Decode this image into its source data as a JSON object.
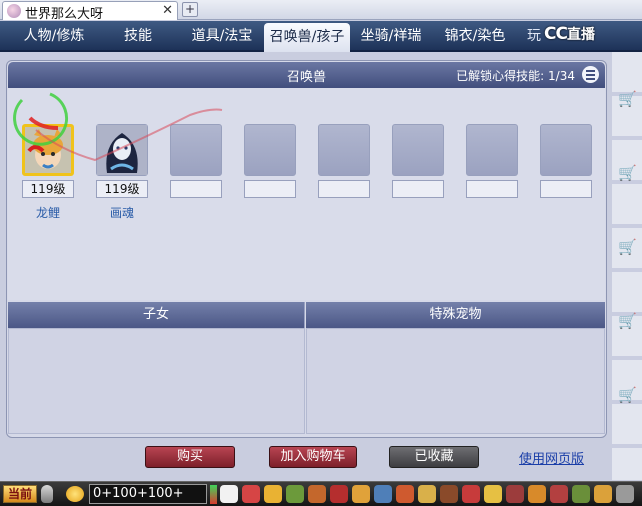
{
  "browser": {
    "tab_title": "世界那么大呀",
    "close_glyph": "✕",
    "newtab_glyph": "+"
  },
  "nav": {
    "tabs": [
      {
        "label": "人物/修炼"
      },
      {
        "label": "技能"
      },
      {
        "label": "道具/法宝"
      },
      {
        "label": "召唤兽/孩子"
      },
      {
        "label": "坐骑/祥瑞"
      },
      {
        "label": "锦衣/染色"
      },
      {
        "label": "玩"
      }
    ],
    "active_index": 3
  },
  "cc_logo": {
    "cc": "CC",
    "text": "直播"
  },
  "panel": {
    "title": "召唤兽",
    "skill_info_label": "已解锁心得技能:",
    "skill_info_value": "1/34"
  },
  "pets": [
    {
      "level": "119级",
      "name": "龙鲤",
      "icon": "dragon-carp-portrait-icon"
    },
    {
      "level": "119级",
      "name": "画魂",
      "icon": "painted-soul-portrait-icon"
    },
    {
      "level": "",
      "name": ""
    },
    {
      "level": "",
      "name": ""
    },
    {
      "level": "",
      "name": ""
    },
    {
      "level": "",
      "name": ""
    },
    {
      "level": "",
      "name": ""
    },
    {
      "level": "",
      "name": ""
    }
  ],
  "sections": {
    "children": "子女",
    "special_pets": "特殊宠物"
  },
  "buttons": {
    "buy": "购买",
    "add_to_cart": "加入购物车",
    "favorited": "已收藏",
    "web_version": "使用网页版"
  },
  "taskbar": {
    "channel": "当前",
    "chat_input": "0+100+100+"
  },
  "colors": {
    "nav_bg": "#2b416a",
    "selected_border": "#f0c31b",
    "buy_button": "#9c2e3a",
    "link": "#1a3ea8"
  }
}
